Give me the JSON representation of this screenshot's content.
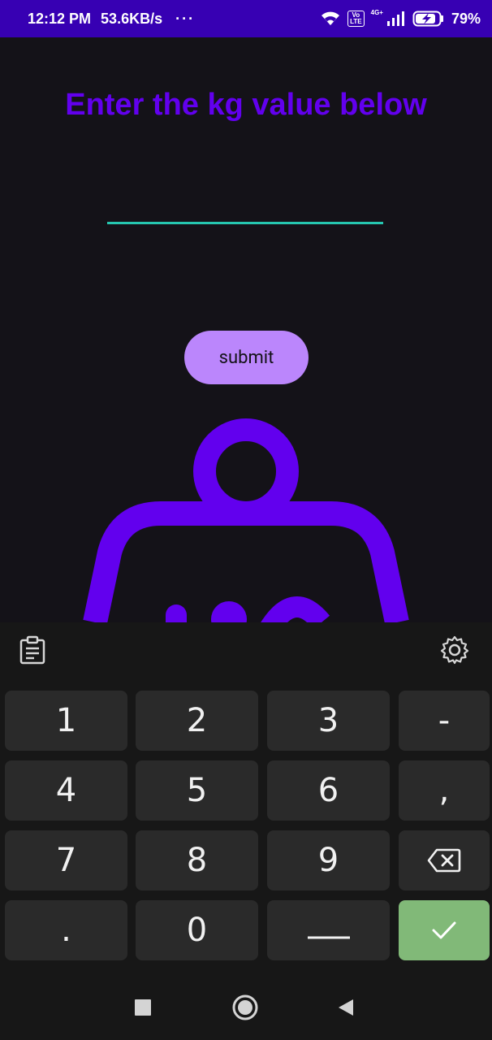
{
  "status_bar": {
    "time": "12:12 PM",
    "speed": "53.6KB/s",
    "dots": "···",
    "volte_top": "Vo",
    "volte_bottom": "LTE",
    "network": "4G+",
    "battery": "79%"
  },
  "main": {
    "heading": "Enter the kg value below",
    "input_value": "",
    "submit_label": "submit",
    "graphic_text": "KG"
  },
  "keyboard": {
    "rows": [
      [
        "1",
        "2",
        "3",
        "-"
      ],
      [
        "4",
        "5",
        "6",
        ","
      ],
      [
        "7",
        "8",
        "9",
        "⌫"
      ],
      [
        ".",
        "0",
        "space",
        "✓"
      ]
    ],
    "keys": {
      "k1": "1",
      "k2": "2",
      "k3": "3",
      "dash": "-",
      "k4": "4",
      "k5": "5",
      "k6": "6",
      "comma": ",",
      "k7": "7",
      "k8": "8",
      "k9": "9",
      "dot": ".",
      "k0": "0"
    }
  },
  "colors": {
    "status_bar": "#3700b3",
    "heading": "#6200ee",
    "underline": "#26c6b0",
    "button": "#bb86fc",
    "weight": "#6200ee",
    "done_key": "#81b978"
  },
  "icons": {
    "clipboard": "clipboard-icon",
    "settings": "gear-icon",
    "backspace": "backspace-icon",
    "enter": "check-icon",
    "nav_recents": "square-icon",
    "nav_home": "circle-icon",
    "nav_back": "triangle-back-icon"
  }
}
